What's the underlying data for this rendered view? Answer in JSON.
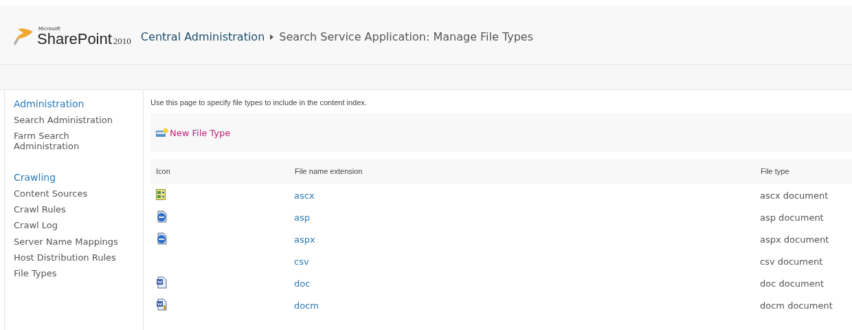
{
  "brand": {
    "company": "Microsoft",
    "product": "SharePoint",
    "version": "2010"
  },
  "breadcrumb": [
    {
      "label": "Central Administration",
      "kind": "link"
    },
    {
      "label": "Search Service Application: Manage File Types",
      "kind": "current"
    }
  ],
  "sidebar": {
    "sections": [
      {
        "heading": "Administration",
        "items": [
          "Search Administration",
          "Farm Search Administration"
        ]
      },
      {
        "heading": "Crawling",
        "items": [
          "Content Sources",
          "Crawl Rules",
          "Crawl Log",
          "Server Name Mappings",
          "Host Distribution Rules",
          "File Types"
        ]
      }
    ]
  },
  "intro": "Use this page to specify file types to include in the content index.",
  "toolbar": {
    "new_button": "New File Type"
  },
  "table": {
    "columns": [
      "Icon",
      "File name extension",
      "File type"
    ],
    "rows": [
      {
        "kind": "control",
        "extension": "ascx",
        "file_type": "ascx document"
      },
      {
        "kind": "web",
        "extension": "asp",
        "file_type": "asp document"
      },
      {
        "kind": "web",
        "extension": "aspx",
        "file_type": "aspx document"
      },
      {
        "kind": "plain",
        "extension": "csv",
        "file_type": "csv document"
      },
      {
        "kind": "word",
        "extension": "doc",
        "file_type": "doc document"
      },
      {
        "kind": "macro",
        "extension": "docm",
        "file_type": "docm document"
      }
    ]
  }
}
